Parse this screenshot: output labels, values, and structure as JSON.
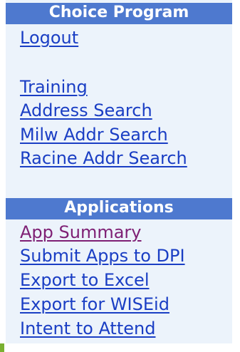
{
  "colors": {
    "panel_bg": "#ecf3fb",
    "header_bg": "#4e79cf",
    "header_text": "#ffffff",
    "link": "#1a3ec4",
    "visited_link": "#7e1f74"
  },
  "choice_program": {
    "header": "Choice Program",
    "logout": "Logout",
    "links": [
      "Training",
      "Address Search",
      "Milw Addr Search",
      "Racine Addr Search"
    ]
  },
  "applications": {
    "header": "Applications",
    "links": [
      "App Summary",
      "Submit Apps to DPI",
      "Export to Excel",
      "Export for WISEid",
      "Intent to Attend"
    ]
  }
}
